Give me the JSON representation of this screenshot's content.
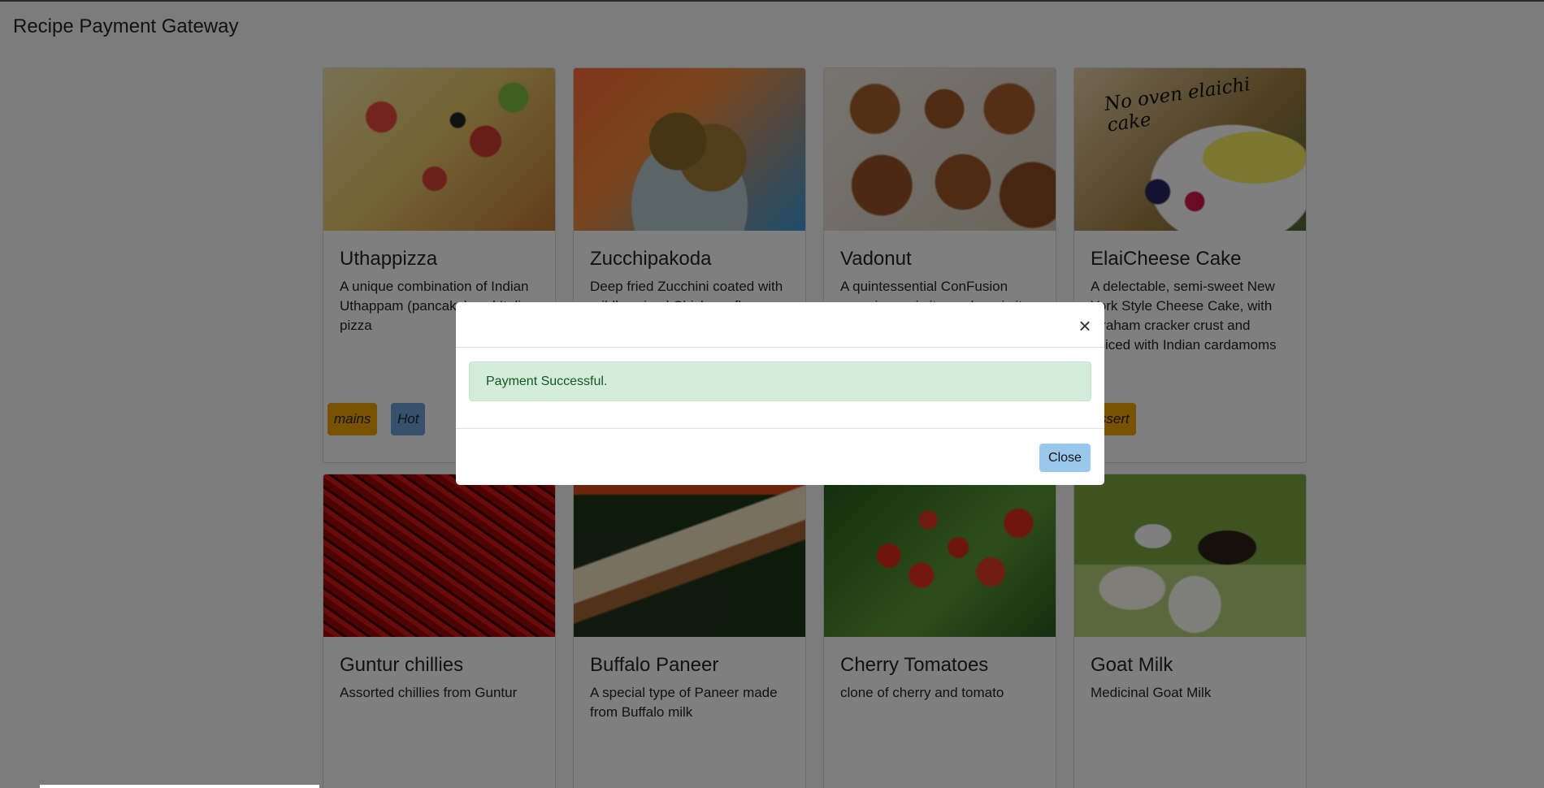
{
  "navbar": {
    "brand": "Recipe Payment Gateway"
  },
  "cards": [
    {
      "title": "Uthappizza",
      "description": "A unique combination of Indian Uthappam (pancake) and Italian pizza",
      "tags": [
        "mains",
        "Hot"
      ],
      "image": "pizza"
    },
    {
      "title": "Zucchipakoda",
      "description": "Deep fried Zucchini coated with mildly spiced Chickpea flour batter",
      "tags": [],
      "image": "zucchini-pakoda"
    },
    {
      "title": "Vadonut",
      "description": "A quintessential ConFusion experience, is it a vada or is it a donut?",
      "tags": [],
      "image": "vadonut"
    },
    {
      "title": "ElaiCheese Cake",
      "description": "A delectable, semi-sweet New York Style Cheese Cake, with Graham cracker crust and spiced with Indian cardamoms",
      "tags": [
        "dessert"
      ],
      "image_text": "No oven elaichi cake"
    },
    {
      "title": "Guntur chillies",
      "description": "Assorted chillies from Guntur",
      "tags": [],
      "image": "chillies"
    },
    {
      "title": "Buffalo Paneer",
      "description": "A special type of Paneer made from Buffalo milk",
      "tags": [],
      "image": "paneer"
    },
    {
      "title": "Cherry Tomatoes",
      "description": "clone of cherry and tomato",
      "tags": [],
      "image": "cherry-tomatoes"
    },
    {
      "title": "Goat Milk",
      "description": "Medicinal Goat Milk",
      "tags": [],
      "image": "goat-milk"
    }
  ],
  "modal": {
    "message": "Payment Successful.",
    "close_symbol": "×",
    "close_button": "Close"
  },
  "colors": {
    "alert_bg": "#d4edda",
    "alert_text": "#155724",
    "mains_tag": "#f0a500",
    "hot_tag": "#6fa1d6",
    "close_button": "#9ac8ec",
    "overlay": "rgba(0,0,0,0.5)"
  }
}
